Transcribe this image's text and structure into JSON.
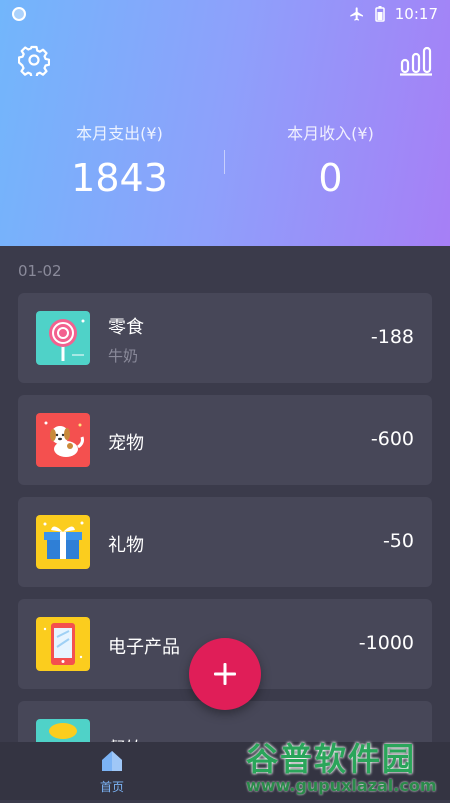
{
  "status": {
    "time": "10:17"
  },
  "summary": {
    "expense_label": "本月支出(¥)",
    "expense_value": "1843",
    "income_label": "本月收入(¥)",
    "income_value": "0"
  },
  "date_group": "01-02",
  "records": [
    {
      "icon": "lollipop-icon",
      "title": "零食",
      "note": "牛奶",
      "amount": "-188",
      "icon_bg": "#4fd2c8"
    },
    {
      "icon": "dog-icon",
      "title": "宠物",
      "note": "",
      "amount": "-600",
      "icon_bg": "#f4504f"
    },
    {
      "icon": "gift-box-icon",
      "title": "礼物",
      "note": "",
      "amount": "-50",
      "icon_bg": "#fbcd1e"
    },
    {
      "icon": "phone-icon",
      "title": "电子产品",
      "note": "",
      "amount": "-1000",
      "icon_bg": "#fbcd1e"
    },
    {
      "icon": "partial-icon",
      "title": "餐饮",
      "note": "",
      "amount": "",
      "icon_bg": "#4fd2c8"
    }
  ],
  "tabbar": {
    "home_label": "首页"
  },
  "watermark": {
    "line1": "谷普软件园",
    "line2": "www.gupuxlazal.com"
  },
  "colors": {
    "fab": "#e01e58",
    "card": "#474758",
    "background": "#3b3b4b",
    "accent": "#7bb3f5"
  }
}
